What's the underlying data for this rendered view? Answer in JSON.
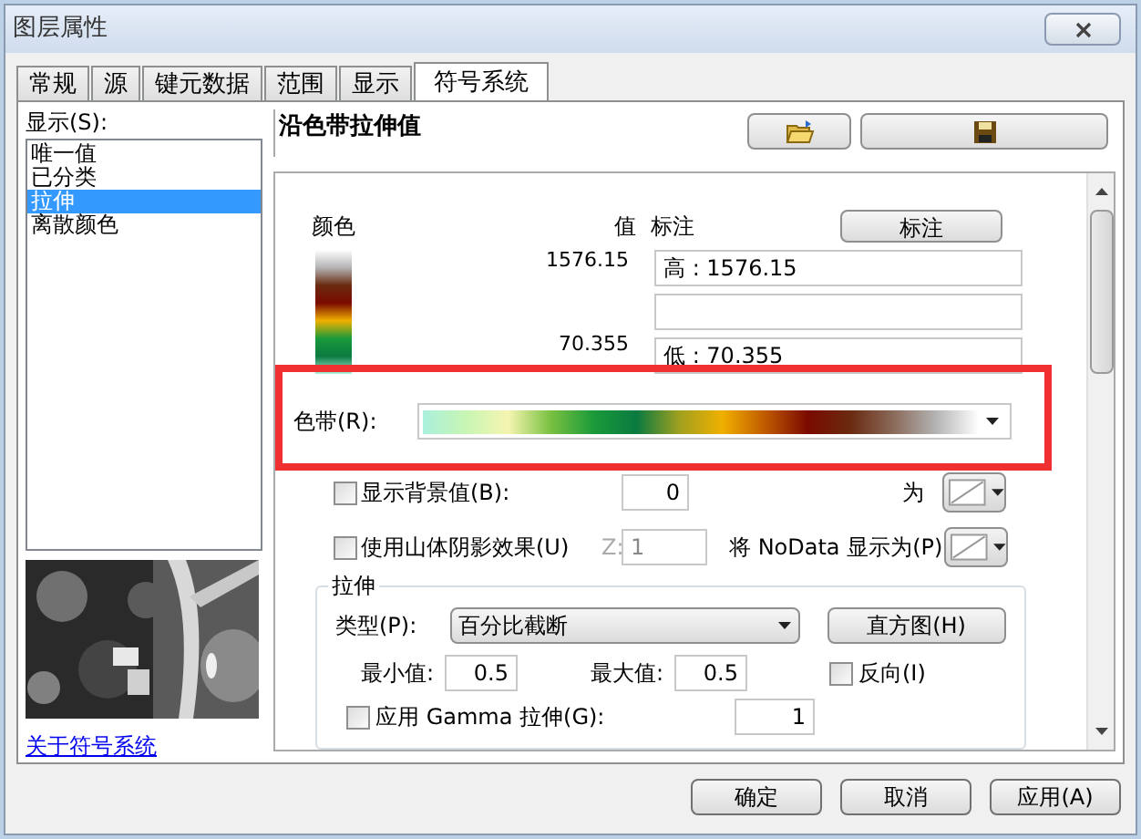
{
  "window": {
    "title": "图层属性"
  },
  "tabs": [
    {
      "label": "常规",
      "selected": false
    },
    {
      "label": "源",
      "selected": false
    },
    {
      "label": "键元数据",
      "selected": false
    },
    {
      "label": "范围",
      "selected": false
    },
    {
      "label": "显示",
      "selected": false
    },
    {
      "label": "符号系统",
      "selected": true
    }
  ],
  "show_label": "显示(S):",
  "renderers": [
    {
      "label": "唯一值",
      "selected": false
    },
    {
      "label": "已分类",
      "selected": false
    },
    {
      "label": "拉伸",
      "selected": true
    },
    {
      "label": "离散颜色",
      "selected": false
    }
  ],
  "help_link": "关于符号系统",
  "panel_title": "沿色带拉伸值",
  "legend": {
    "color_header": "颜色",
    "value_header": "值",
    "label_header": "标注",
    "label_button": "标注",
    "high_value": "1576.15",
    "high_label": "高 : 1576.15",
    "low_value": "70.355",
    "low_label": "低 : 70.355"
  },
  "color_ramp": {
    "label": "色带(R):"
  },
  "background": {
    "label": "显示背景值(B):",
    "checked": false,
    "value": "0",
    "as_label": "为"
  },
  "hillshade": {
    "label": "使用山体阴影效果(U)",
    "checked": false,
    "z_label": "Z:",
    "z_value": "1"
  },
  "nodata_label": "将 NoData 显示为(P)",
  "stretch": {
    "title": "拉伸",
    "type_label": "类型(P):",
    "type_value": "百分比截断",
    "histogram_button": "直方图(H)",
    "min_label": "最小值:",
    "min_value": "0.5",
    "max_label": "最大值:",
    "max_value": "0.5",
    "invert_label": "反向(I)",
    "invert_checked": false,
    "gamma_label": "应用 Gamma 拉伸(G):",
    "gamma_checked": false,
    "gamma_value": "1"
  },
  "buttons": [
    "确定",
    "取消",
    "应用(A)"
  ]
}
